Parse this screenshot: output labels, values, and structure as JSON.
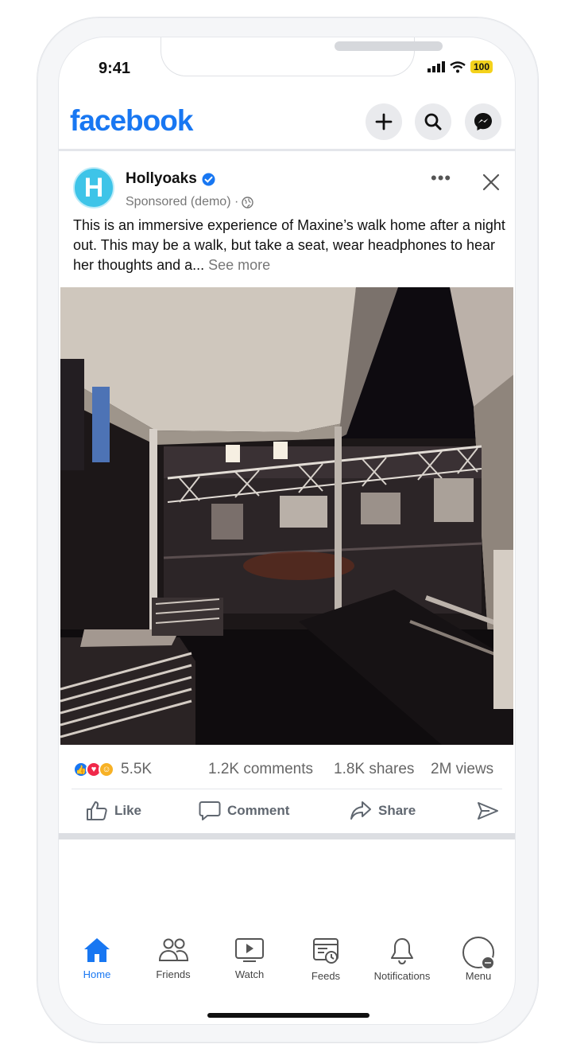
{
  "status_bar": {
    "time": "9:41",
    "battery": "100"
  },
  "header": {
    "logo": "facebook",
    "icons": [
      "add-icon",
      "search-icon",
      "messenger-icon"
    ]
  },
  "post": {
    "author": "Hollyoaks",
    "avatar_letter": "H",
    "sponsored": "Sponsored (demo) ·",
    "text": "This is an immersive experience of Maxine’s walk home after a night out. This may be a walk, but take a seat, wear headphones to hear her thoughts and a...",
    "see_more": "See more",
    "stats": {
      "reactions": "5.5K",
      "comments": "1.2K comments",
      "shares": "1.8K shares",
      "views": "2M views"
    },
    "actions": {
      "like": "Like",
      "comment": "Comment",
      "share": "Share"
    }
  },
  "bottom_nav": {
    "items": [
      {
        "label": "Home",
        "icon": "home-icon",
        "active": true
      },
      {
        "label": "Friends",
        "icon": "friends-icon",
        "active": false
      },
      {
        "label": "Watch",
        "icon": "watch-icon",
        "active": false
      },
      {
        "label": "Feeds",
        "icon": "feeds-icon",
        "active": false
      },
      {
        "label": "Notifications",
        "icon": "bell-icon",
        "active": false
      },
      {
        "label": "Menu",
        "icon": "menu-avatar-icon",
        "active": false
      }
    ]
  },
  "colors": {
    "brand": "#1877f2",
    "verified": "#1877f2",
    "battery": "#f4d21c"
  }
}
